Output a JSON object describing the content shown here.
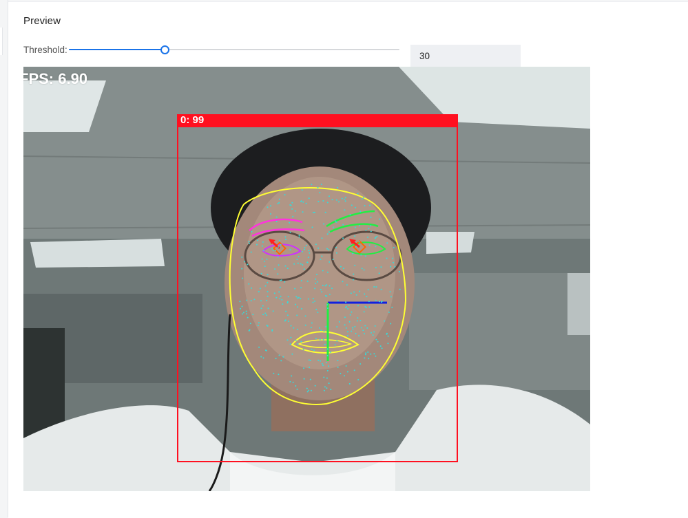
{
  "preview": {
    "title": "Preview"
  },
  "threshold": {
    "label": "Threshold:",
    "value": "30",
    "fraction": 0.29
  },
  "overlay": {
    "fps_text": "FPS: 6.90",
    "detection_label": "0: 99"
  },
  "colors": {
    "accent": "#1a73e8",
    "box": "#ff1020",
    "contour": "#ffff33",
    "brow_left": "#ff33dd",
    "brow_right": "#22ee44",
    "landmark": "#33dddd",
    "gaze": "#ff2020",
    "pose_x": "#1020e0",
    "pose_y": "#22ee44"
  },
  "icons": {
    "slider_thumb": "circle-handle-icon"
  }
}
